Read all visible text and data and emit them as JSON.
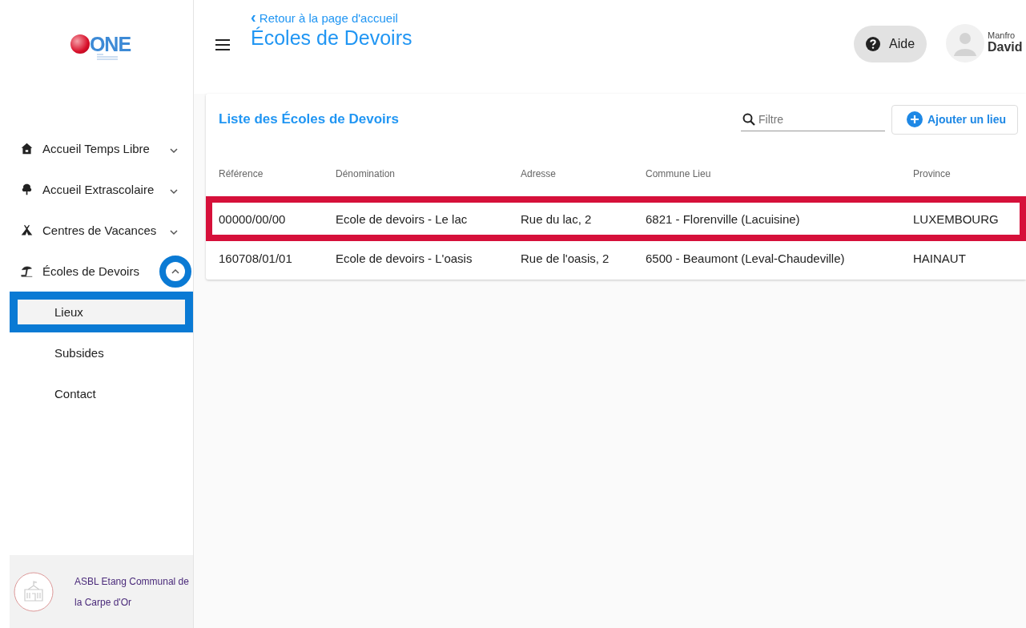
{
  "logo": {
    "mark": "ONE"
  },
  "sidebar": {
    "items": [
      {
        "label": "Accueil Temps Libre",
        "expanded": false
      },
      {
        "label": "Accueil Extrascolaire",
        "expanded": false
      },
      {
        "label": "Centres de Vacances",
        "expanded": false
      },
      {
        "label": "Écoles de Devoirs",
        "expanded": true,
        "highlighted": true,
        "children": [
          {
            "label": "Lieux",
            "selected": true
          },
          {
            "label": "Subsides",
            "selected": false
          },
          {
            "label": "Contact",
            "selected": false
          }
        ]
      }
    ],
    "organization": "ASBL Etang Communal de la Carpe d'Or"
  },
  "header": {
    "back_icon": "‹",
    "back_link": "Retour à la page d'accueil",
    "title": "Écoles de Devoirs",
    "help_button": "Aide",
    "user": {
      "first_line": "Manfro",
      "second_line": "David"
    }
  },
  "card": {
    "title": "Liste des Écoles de Devoirs",
    "filter": {
      "placeholder": "Filtre"
    },
    "add_button": "Ajouter un lieu",
    "table": {
      "columns": [
        "Référence",
        "Dénomination",
        "Adresse",
        "Commune Lieu",
        "Province"
      ],
      "rows": [
        {
          "cells": [
            "00000/00/00",
            "Ecole de devoirs - Le lac",
            "Rue du lac, 2",
            "6821 - Florenville (Lacuisine)",
            "LUXEMBOURG"
          ],
          "highlighted": true
        },
        {
          "cells": [
            "160708/01/01",
            "Ecole de devoirs - L'oasis",
            "Rue de l'oasis, 2",
            "6500 - Beaumont (Leval-Chaudeville)",
            "HAINAUT"
          ],
          "highlighted": false
        }
      ]
    }
  }
}
